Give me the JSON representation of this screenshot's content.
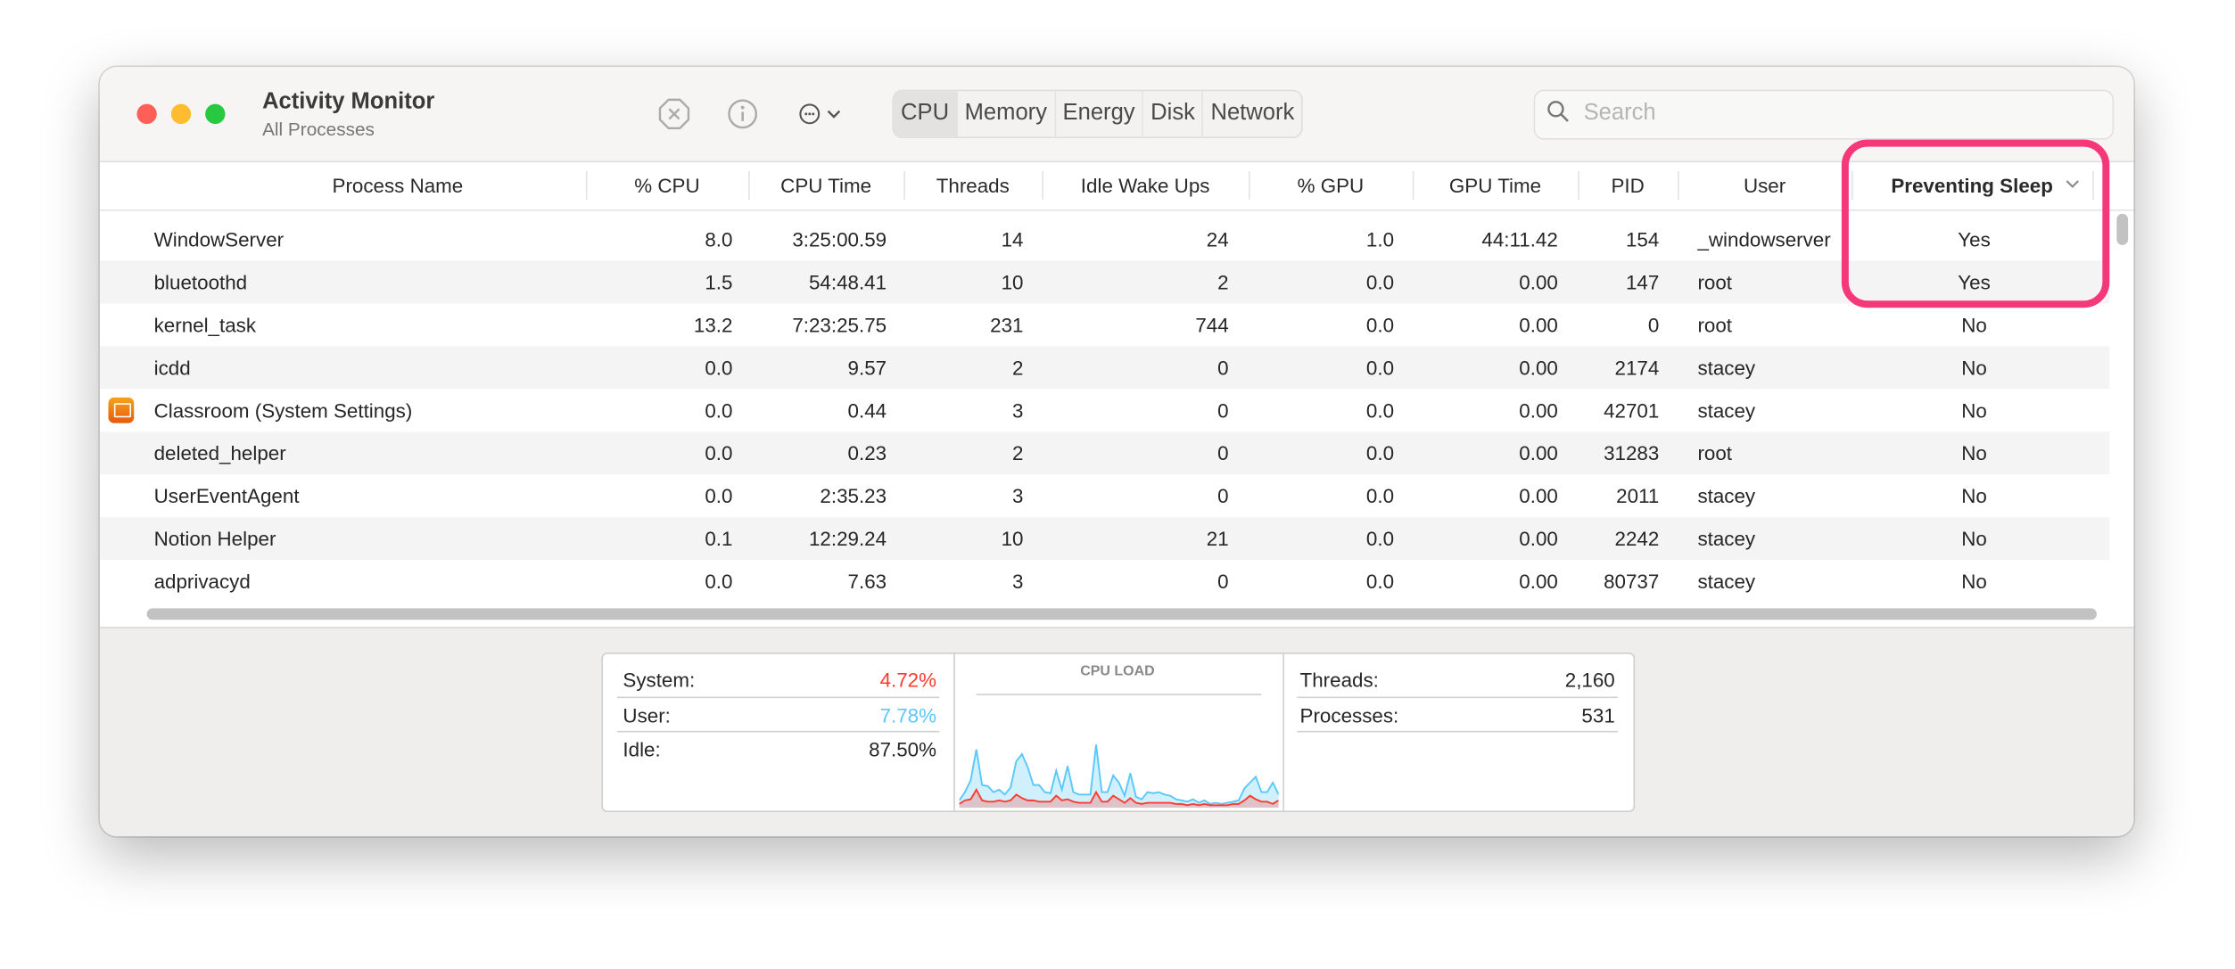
{
  "window": {
    "title": "Activity Monitor",
    "subtitle": "All Processes"
  },
  "toolbar": {
    "stop_icon": "stop-process-icon",
    "info_icon": "info-icon",
    "more_icon": "ellipsis-circle-icon",
    "tabs": [
      {
        "label": "CPU",
        "active": true
      },
      {
        "label": "Memory"
      },
      {
        "label": "Energy"
      },
      {
        "label": "Disk"
      },
      {
        "label": "Network"
      }
    ],
    "search_placeholder": "Search"
  },
  "table": {
    "columns": [
      "Process Name",
      "% CPU",
      "CPU Time",
      "Threads",
      "Idle Wake Ups",
      "% GPU",
      "GPU Time",
      "PID",
      "User",
      "Preventing Sleep"
    ],
    "sorted_column": "Preventing Sleep",
    "rows": [
      [
        "WindowServer",
        "8.0",
        "3:25:00.59",
        "14",
        "24",
        "1.0",
        "44:11.42",
        "154",
        "_windowserver",
        "Yes"
      ],
      [
        "bluetoothd",
        "1.5",
        "54:48.41",
        "10",
        "2",
        "0.0",
        "0.00",
        "147",
        "root",
        "Yes"
      ],
      [
        "kernel_task",
        "13.2",
        "7:23:25.75",
        "231",
        "744",
        "0.0",
        "0.00",
        "0",
        "root",
        "No"
      ],
      [
        "icdd",
        "0.0",
        "9.57",
        "2",
        "0",
        "0.0",
        "0.00",
        "2174",
        "stacey",
        "No"
      ],
      [
        "Classroom (System Settings)",
        "0.0",
        "0.44",
        "3",
        "0",
        "0.0",
        "0.00",
        "42701",
        "stacey",
        "No"
      ],
      [
        "deleted_helper",
        "0.0",
        "0.23",
        "2",
        "0",
        "0.0",
        "0.00",
        "31283",
        "root",
        "No"
      ],
      [
        "UserEventAgent",
        "0.0",
        "2:35.23",
        "3",
        "0",
        "0.0",
        "0.00",
        "2011",
        "stacey",
        "No"
      ],
      [
        "Notion Helper",
        "0.1",
        "12:29.24",
        "10",
        "21",
        "0.0",
        "0.00",
        "2242",
        "stacey",
        "No"
      ],
      [
        "adprivacyd",
        "0.0",
        "7.63",
        "3",
        "0",
        "0.0",
        "0.00",
        "80737",
        "stacey",
        "No"
      ]
    ]
  },
  "summary": {
    "system_label": "System:",
    "system_value": "4.72%",
    "user_label": "User:",
    "user_value": "7.78%",
    "idle_label": "Idle:",
    "idle_value": "87.50%",
    "threads_label": "Threads:",
    "threads_value": "2,160",
    "processes_label": "Processes:",
    "processes_value": "531",
    "colors": {
      "system": "#ff3b30",
      "user": "#5ac8fa",
      "highlight": "#f5387a"
    }
  },
  "chart_data": {
    "type": "area",
    "title": "CPU LOAD",
    "series": [
      {
        "key": "user",
        "values": [
          5,
          12,
          22,
          48,
          18,
          17,
          12,
          14,
          10,
          16,
          38,
          44,
          33,
          18,
          18,
          12,
          11,
          30,
          14,
          34,
          12,
          10,
          10,
          10,
          52,
          12,
          12,
          26,
          20,
          9,
          28,
          8,
          6,
          12,
          11,
          12,
          10,
          9,
          6,
          5,
          4,
          6,
          3,
          5,
          2,
          3,
          2,
          3,
          4,
          5,
          15,
          20,
          25,
          12,
          12,
          20,
          10
        ]
      },
      {
        "key": "system",
        "values": [
          2,
          5,
          6,
          14,
          5,
          4,
          4,
          5,
          4,
          5,
          10,
          7,
          5,
          5,
          4,
          4,
          4,
          9,
          5,
          6,
          4,
          3,
          3,
          3,
          12,
          4,
          4,
          9,
          6,
          3,
          7,
          3,
          2,
          3,
          3,
          3,
          3,
          3,
          2,
          2,
          1,
          2,
          1,
          2,
          1,
          1,
          1,
          1,
          2,
          2,
          5,
          9,
          6,
          4,
          4,
          2,
          5
        ]
      }
    ],
    "ylim": [
      0,
      100
    ]
  }
}
